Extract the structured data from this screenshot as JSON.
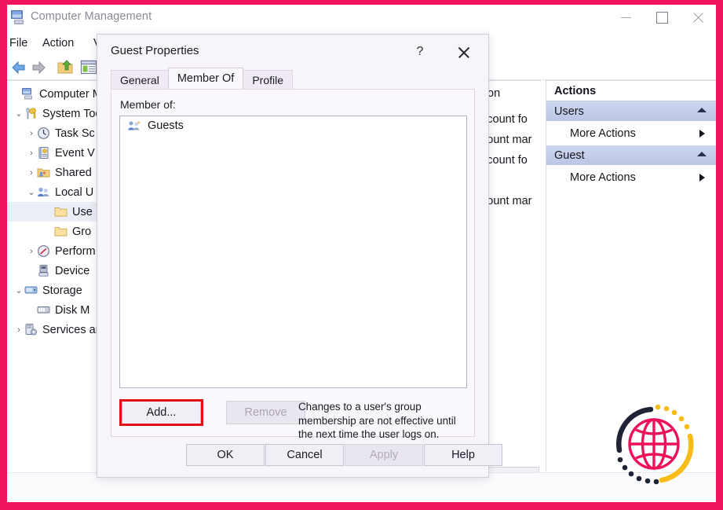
{
  "window": {
    "title": "Computer Management",
    "icon": "computer-management-icon",
    "minimize_label": "—",
    "maximize_label": "□",
    "close_label": "✕"
  },
  "menubar": {
    "items": [
      "File",
      "Action",
      "V"
    ]
  },
  "toolbar": {
    "items": [
      "back-arrow-icon",
      "forward-arrow-icon",
      "up-folder-icon",
      "show-hide-console-tree-icon"
    ]
  },
  "tree": {
    "nodes": [
      {
        "label": "Computer Man",
        "icon": "computer-icon",
        "depth": 0,
        "twisty": "",
        "selected": false
      },
      {
        "label": "System Too",
        "icon": "system-tools-icon",
        "depth": 1,
        "twisty": "⌄",
        "selected": false
      },
      {
        "label": "Task Sc",
        "icon": "task-scheduler-icon",
        "depth": 2,
        "twisty": "›",
        "selected": false
      },
      {
        "label": "Event V",
        "icon": "event-viewer-icon",
        "depth": 2,
        "twisty": "›",
        "selected": false
      },
      {
        "label": "Shared",
        "icon": "shared-folders-icon",
        "depth": 2,
        "twisty": "›",
        "selected": false
      },
      {
        "label": "Local U",
        "icon": "local-users-groups-icon",
        "depth": 2,
        "twisty": "⌄",
        "selected": false
      },
      {
        "label": "Use",
        "icon": "folder-icon",
        "depth": 3,
        "twisty": "",
        "selected": true
      },
      {
        "label": "Gro",
        "icon": "folder-icon",
        "depth": 3,
        "twisty": "",
        "selected": false
      },
      {
        "label": "Perform",
        "icon": "performance-icon",
        "depth": 2,
        "twisty": "›",
        "selected": false
      },
      {
        "label": "Device",
        "icon": "device-manager-icon",
        "depth": 2,
        "twisty": "",
        "selected": false
      },
      {
        "label": "Storage",
        "icon": "storage-icon",
        "depth": 1,
        "twisty": "⌄",
        "selected": false
      },
      {
        "label": "Disk M",
        "icon": "disk-management-icon",
        "depth": 2,
        "twisty": "",
        "selected": false
      },
      {
        "label": "Services an",
        "icon": "services-applications-icon",
        "depth": 1,
        "twisty": "›",
        "selected": false
      }
    ]
  },
  "list_pane": {
    "column_header_fragment": "on",
    "rows": [
      "ccount fo",
      "count mar",
      "ccount fo",
      "",
      "count mar"
    ],
    "hscrollbar": {
      "left_arrow": "‹",
      "right_arrow": "›"
    }
  },
  "actions_pane": {
    "title": "Actions",
    "groups": [
      {
        "label": "Users",
        "collapse_icon": "collapse-caret-icon",
        "items": [
          {
            "label": "More Actions",
            "submenu_icon": "submenu-caret-icon"
          }
        ]
      },
      {
        "label": "Guest",
        "collapse_icon": "collapse-caret-icon",
        "items": [
          {
            "label": "More Actions",
            "submenu_icon": "submenu-caret-icon"
          }
        ]
      }
    ]
  },
  "dialog": {
    "title": "Guest Properties",
    "help_label": "?",
    "close_icon": "close-icon",
    "tabs": [
      {
        "label": "General",
        "active": false
      },
      {
        "label": "Member Of",
        "active": true
      },
      {
        "label": "Profile",
        "active": false
      }
    ],
    "member_of_label": "Member of:",
    "members": [
      {
        "name": "Guests",
        "icon": "group-icon"
      }
    ],
    "add_button": "Add...",
    "remove_button": "Remove",
    "note": "Changes to a user's group membership are not effective until the next time the user logs on.",
    "footer_buttons": [
      {
        "label": "OK",
        "disabled": false
      },
      {
        "label": "Cancel",
        "disabled": false
      },
      {
        "label": "Apply",
        "disabled": true
      },
      {
        "label": "Help",
        "disabled": false
      }
    ],
    "highlight_color": "#e10e18",
    "highlighted_element": "add-button"
  },
  "watermark": {
    "icon": "globe-logo",
    "colors": {
      "globe": "#ee1158",
      "arc_dark": "#1e2436",
      "arc_yellow": "#f7bc17"
    }
  },
  "theme": {
    "frame_accent": "#f0135e",
    "selection_blue": "#c3cdea",
    "dialog_bg": "#f7f4fa"
  }
}
